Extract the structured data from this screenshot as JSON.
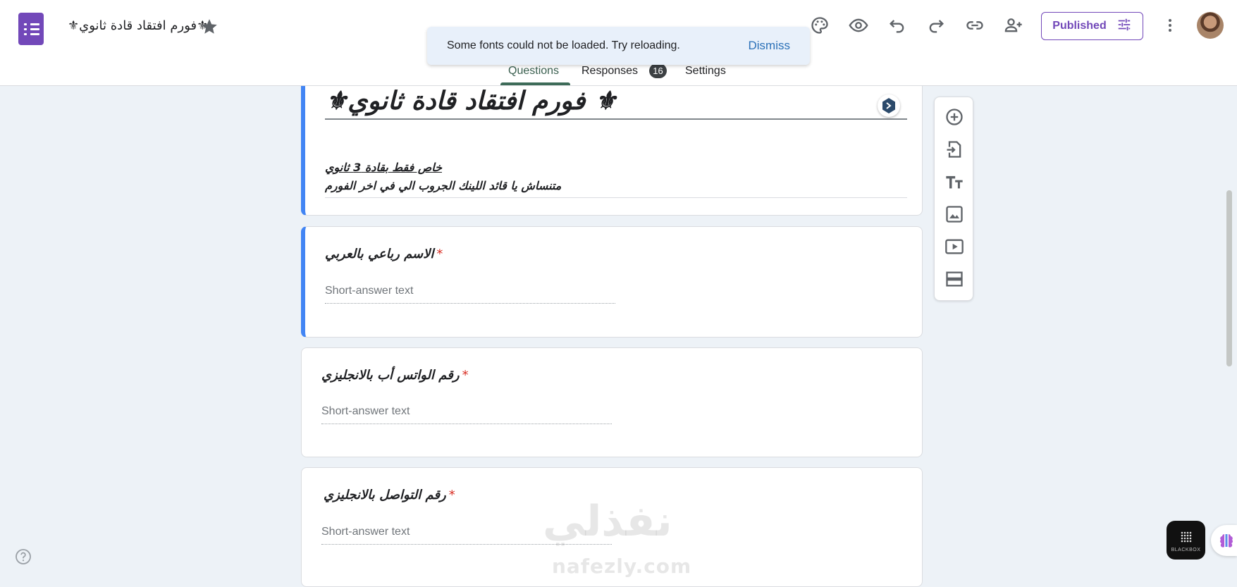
{
  "header": {
    "doc_title": "⚜فورم افتقاد قادة ثانوي⚜",
    "publish_label": "Published",
    "icons": [
      "palette-icon",
      "preview-eye-icon",
      "undo-icon",
      "redo-icon",
      "link-icon",
      "add-collaborator-icon",
      "tune-icon",
      "more-vert-icon"
    ]
  },
  "tabs": {
    "questions": "Questions",
    "responses": "Responses",
    "responses_count": "16",
    "settings": "Settings"
  },
  "snackbar": {
    "message": "Some fonts could not be loaded. Try reloading.",
    "dismiss": "Dismiss"
  },
  "form": {
    "title": "⚜فورم افتقاد قادة ثانوي ⚜",
    "description_line1": "خاص فقط بقادة 3 ثانوي",
    "description_line2": "متنساش يا قائد اللينك الجروب الي في اخر الفورم"
  },
  "questions": [
    {
      "title": "الاسم رباعي بالعربي",
      "required": "*",
      "placeholder": "Short-answer text"
    },
    {
      "title": "رقم الواتس أب بالانجليزي",
      "required": "*",
      "placeholder": "Short-answer text"
    },
    {
      "title": "رقم التواصل بالانجليزي",
      "required": "*",
      "placeholder": "Short-answer text"
    }
  ],
  "side_toolbar": [
    "add-question-icon",
    "import-questions-icon",
    "add-title-icon",
    "add-image-icon",
    "add-video-icon",
    "add-section-icon"
  ],
  "watermark": {
    "arabic": "نفذلي",
    "latin": "nafezly.com"
  },
  "blackbox": {
    "label": "BLACKBOX"
  },
  "colors": {
    "accent": "#7248b9",
    "selected_border": "#4285f4",
    "background": "#edf2f7",
    "required": "#d93025"
  }
}
